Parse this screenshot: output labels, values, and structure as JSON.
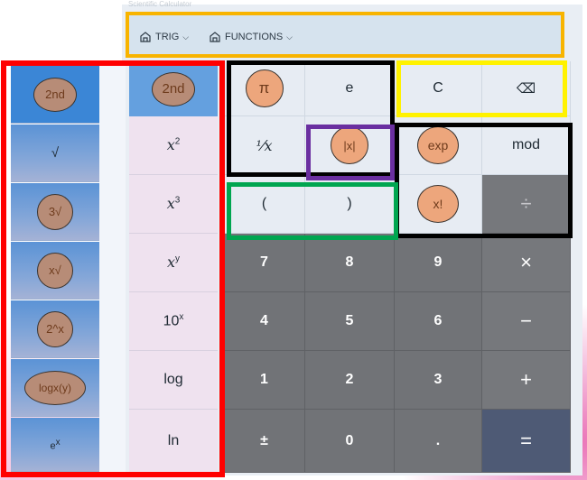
{
  "window": {
    "title": "Scientific Calculator"
  },
  "toolbar": {
    "trig_label": "TRIG",
    "functions_label": "FUNCTIONS"
  },
  "left_panel": {
    "items": [
      {
        "label": "2nd"
      },
      {
        "label": "√"
      },
      {
        "label": "3√"
      },
      {
        "label": "x√"
      },
      {
        "label": "2^x"
      },
      {
        "label": "logx(y)"
      },
      {
        "label": "e",
        "sup": "x"
      }
    ]
  },
  "second_col": {
    "items": [
      {
        "label": "2nd"
      },
      {
        "label": "x",
        "sup": "2"
      },
      {
        "label": "x",
        "sup": "3"
      },
      {
        "label": "x",
        "sup": "y"
      },
      {
        "label": "10",
        "sup": "x"
      },
      {
        "label": "log"
      },
      {
        "label": "ln"
      }
    ]
  },
  "keys": {
    "pi": "π",
    "e": "e",
    "clear": "C",
    "backspace": "⌫",
    "reciprocal": "⅟x",
    "abs": "|x|",
    "exp": "exp",
    "mod": "mod",
    "open_paren": "(",
    "close_paren": ")",
    "factorial": "x!",
    "divide": "÷",
    "seven": "7",
    "eight": "8",
    "nine": "9",
    "multiply": "×",
    "four": "4",
    "five": "5",
    "six": "6",
    "minus": "−",
    "one": "1",
    "two": "2",
    "three": "3",
    "plus": "+",
    "plus_minus": "±",
    "zero": "0",
    "decimal": ".",
    "equals": "="
  },
  "colors": {
    "toolbar_outline": "#f8b400",
    "left_outline": "#ff0000",
    "black_outline": "#000000",
    "yellow_outline": "#fff200",
    "purple_outline": "#6a2fa0",
    "green_outline": "#00a650",
    "circle_brown": "#b78c77",
    "circle_peach": "#eda67c"
  }
}
